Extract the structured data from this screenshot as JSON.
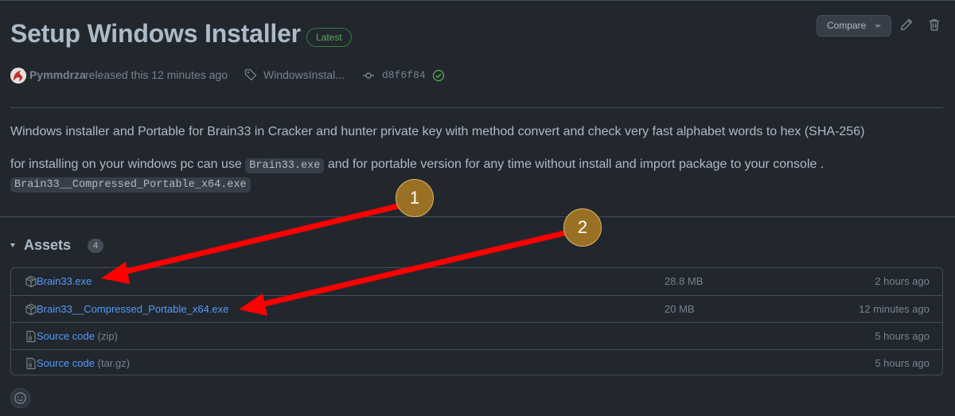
{
  "release": {
    "title": "Setup Windows Installer",
    "badge": "Latest",
    "author": "Pymmdrza",
    "released_text": "released this 12 minutes ago",
    "tag": "WindowsInstal...",
    "commit": "d8f6f84"
  },
  "header_actions": {
    "compare_label": "Compare",
    "edit_icon": "pencil-icon",
    "delete_icon": "trash-icon"
  },
  "description": {
    "line1": "Windows installer and Portable for Brain33 in Cracker and hunter private key with method convert and check very fast alphabet words to hex (SHA-256)",
    "line2_prefix": "for installing on your windows pc can use ",
    "line2_code": "Brain33.exe",
    "line2_suffix": " and for portable version for any time without install and import package to your console .",
    "line3_code": "Brain33__Compressed_Portable_x64.exe"
  },
  "assets": {
    "title": "Assets",
    "count": "4",
    "items": [
      {
        "name": "Brain33.exe",
        "sub": "",
        "size": "28.8 MB",
        "time": "2 hours ago",
        "icon": "package-icon"
      },
      {
        "name": "Brain33__Compressed_Portable_x64.exe",
        "sub": "",
        "size": "20 MB",
        "time": "12 minutes ago",
        "icon": "package-icon"
      },
      {
        "name": "Source code",
        "sub": "(zip)",
        "size": "",
        "time": "5 hours ago",
        "icon": "file-zip-icon"
      },
      {
        "name": "Source code",
        "sub": "(tar.gz)",
        "size": "",
        "time": "5 hours ago",
        "icon": "file-zip-icon"
      }
    ]
  },
  "annotations": {
    "marker1": "1",
    "marker2": "2",
    "arrow_color": "#ff0000"
  },
  "colors": {
    "background": "#22272e",
    "link": "#539bf5",
    "badge_green": "#57ab5a",
    "marker": "#9a7024"
  }
}
